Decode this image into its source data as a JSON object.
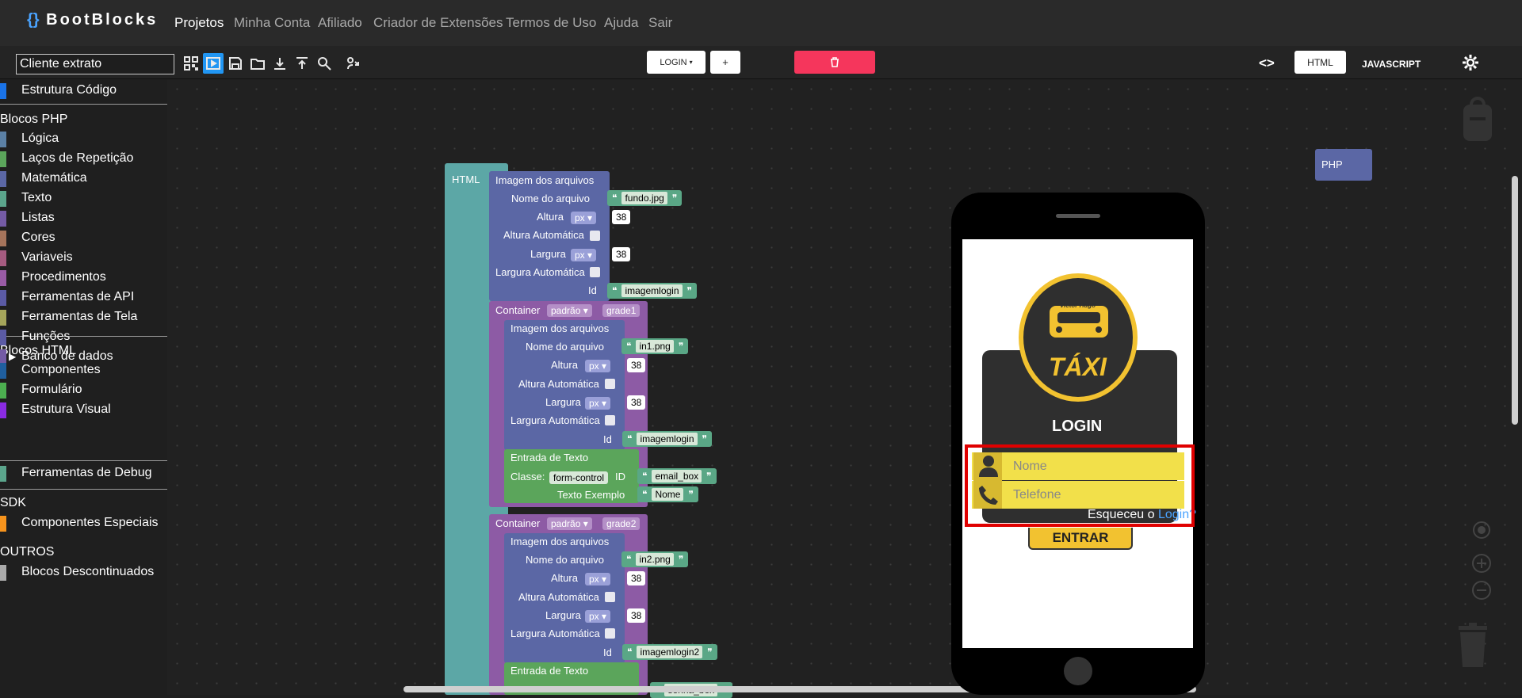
{
  "app": {
    "brand": "BootBlocks"
  },
  "nav": [
    "Projetos",
    "Minha Conta",
    "Afiliado",
    "Criador de Extensões",
    "Termos de Uso",
    "Ajuda",
    "Sair"
  ],
  "toolbar": {
    "project_name": "Cliente extrato",
    "page_select": "LOGIN",
    "add_label": "+",
    "tab_html": "HTML",
    "tab_js": "JAVASCRIPT",
    "code_icon": "<>"
  },
  "sidebar": {
    "top_item": "Estrutura Código",
    "php_title": "Blocos PHP",
    "php_items": [
      {
        "label": "Lógica",
        "color": "#5b80a5"
      },
      {
        "label": "Laços de Repetição",
        "color": "#5ba55b"
      },
      {
        "label": "Matemática",
        "color": "#5b67a5"
      },
      {
        "label": "Texto",
        "color": "#5ba58c"
      },
      {
        "label": "Listas",
        "color": "#745ba5"
      },
      {
        "label": "Cores",
        "color": "#a5745b"
      },
      {
        "label": "Variaveis",
        "color": "#a55b80"
      },
      {
        "label": "Procedimentos",
        "color": "#995ba5"
      },
      {
        "label": "Ferramentas de API",
        "color": "#5b5ba5"
      },
      {
        "label": "Ferramentas de Tela",
        "color": "#a5a55b"
      },
      {
        "label": "Funções",
        "color": "#5b5ba5"
      },
      {
        "label": "Banco de dados",
        "color": "#745ba5"
      }
    ],
    "html_title": "Blocos HTML",
    "html_items": [
      {
        "label": "Componentes",
        "color": "#1f5f9f"
      },
      {
        "label": "Formulário",
        "color": "#4caf50"
      },
      {
        "label": "Estrutura Visual",
        "color": "#8a2be2"
      }
    ],
    "debug_item": "Ferramentas de Debug",
    "sdk_title": "SDK",
    "sdk_item": "Componentes Especiais",
    "other_title": "OUTROS",
    "other_item": "Blocos Descontinuados"
  },
  "blocks": {
    "html_label": "HTML",
    "php_label": "PHP",
    "img_title": "Imagem dos arquivos",
    "file_label": "Nome do arquivo",
    "height_label": "Altura",
    "auto_height_label": "Altura Automática",
    "width_label": "Largura",
    "auto_width_label": "Largura Automática",
    "id_label": "Id",
    "unit": "px",
    "size": "38",
    "container_label": "Container",
    "container_type": "padrão",
    "text_input_title": "Entrada de Texto",
    "class_label": "Classe:",
    "class_value": "form-control",
    "id_inline_label": "ID",
    "placeholder_label": "Texto Exemplo",
    "file1": "fundo.jpg",
    "id1": "imagemlogin",
    "grid1": "grade1",
    "file2": "in1.png",
    "id2": "imagemlogin",
    "input1_id": "email_box",
    "input1_placeholder": "Nome",
    "grid2": "grade2",
    "file3": "in2.png",
    "id3": "imagemlogin2",
    "input2_id": "senha_box"
  },
  "preview": {
    "logo_name": "Victor Hugo",
    "logo_text": "TÁXI",
    "title": "LOGIN",
    "name_placeholder": "Nome",
    "phone_placeholder": "Telefone",
    "forgot_text": "Esqueceu o ",
    "forgot_link": "Login?",
    "submit": "ENTRAR"
  },
  "colors": {
    "accent": "#2196f3",
    "danger": "#f5365c",
    "highlight": "#e00000",
    "taxi_yellow": "#f2c230"
  }
}
